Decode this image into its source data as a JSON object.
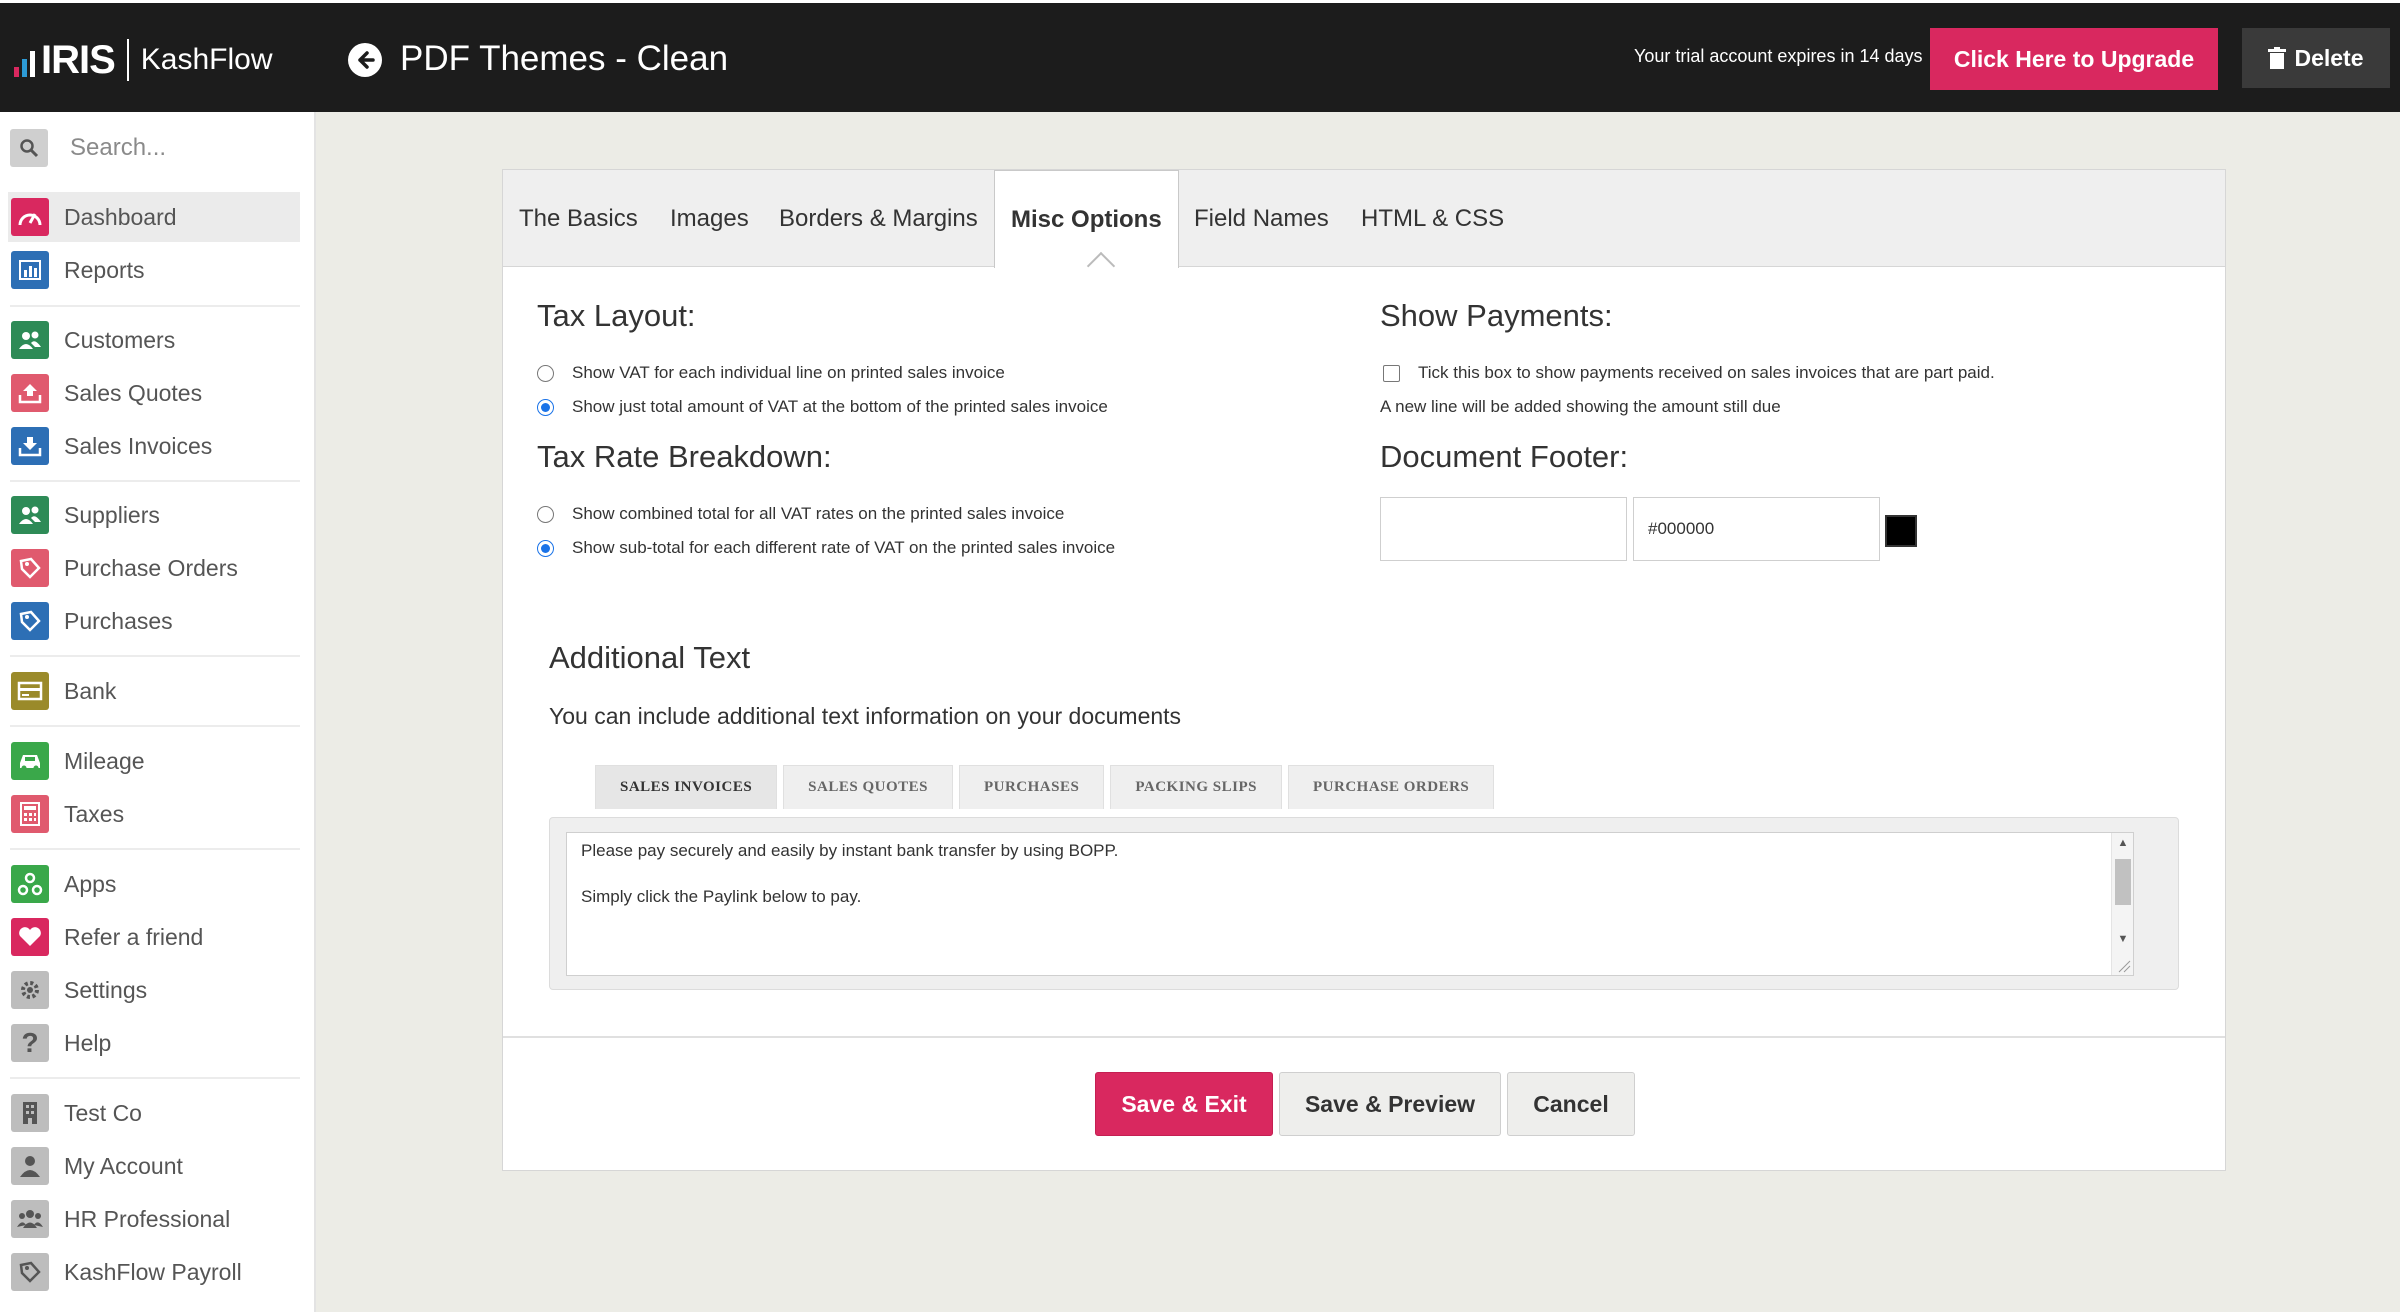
{
  "header": {
    "logo_iris": "IRIS",
    "logo_kashflow": "KashFlow",
    "title": "PDF Themes - Clean",
    "trial_text": "Your trial account expires in 14 days",
    "upgrade_label": "Click Here to Upgrade",
    "delete_label": "Delete"
  },
  "sidebar": {
    "search_placeholder": "Search...",
    "items": [
      {
        "label": "Dashboard",
        "icon": "dashboard-icon",
        "color": "#d9285f"
      },
      {
        "label": "Reports",
        "icon": "bar-chart-icon",
        "color": "#2d6fb5"
      },
      {
        "label": "Customers",
        "icon": "users-icon",
        "color": "#2e8b57"
      },
      {
        "label": "Sales Quotes",
        "icon": "upload-icon",
        "color": "#e05a6e"
      },
      {
        "label": "Sales Invoices",
        "icon": "download-icon",
        "color": "#2d6fb5"
      },
      {
        "label": "Suppliers",
        "icon": "users-icon",
        "color": "#2e8b57"
      },
      {
        "label": "Purchase Orders",
        "icon": "tag-icon",
        "color": "#e05a6e"
      },
      {
        "label": "Purchases",
        "icon": "tag-icon",
        "color": "#2d6fb5"
      },
      {
        "label": "Bank",
        "icon": "card-icon",
        "color": "#9a8a2a"
      },
      {
        "label": "Mileage",
        "icon": "car-icon",
        "color": "#3aa84a"
      },
      {
        "label": "Taxes",
        "icon": "calculator-icon",
        "color": "#e05a6e"
      },
      {
        "label": "Apps",
        "icon": "apps-icon",
        "color": "#3aa84a"
      },
      {
        "label": "Refer a friend",
        "icon": "heart-icon",
        "color": "#d9285f"
      },
      {
        "label": "Settings",
        "icon": "gear-icon",
        "color": "#bdbdbd"
      },
      {
        "label": "Help",
        "icon": "help-icon",
        "color": "#bdbdbd"
      },
      {
        "label": "Test Co",
        "icon": "building-icon",
        "color": "#bdbdbd"
      },
      {
        "label": "My Account",
        "icon": "user-icon",
        "color": "#bdbdbd"
      },
      {
        "label": "HR Professional",
        "icon": "group-icon",
        "color": "#bdbdbd"
      },
      {
        "label": "KashFlow Payroll",
        "icon": "tag-icon",
        "color": "#bdbdbd"
      }
    ]
  },
  "tabs": [
    {
      "label": "The Basics"
    },
    {
      "label": "Images"
    },
    {
      "label": "Borders & Margins"
    },
    {
      "label": "Misc Options"
    },
    {
      "label": "Field Names"
    },
    {
      "label": "HTML & CSS"
    }
  ],
  "tax_layout": {
    "title": "Tax Layout:",
    "options": [
      {
        "label": "Show VAT for each individual line on printed sales invoice",
        "checked": false
      },
      {
        "label": "Show just total amount of VAT at the bottom of the printed sales invoice",
        "checked": true
      }
    ]
  },
  "tax_rate": {
    "title": "Tax Rate Breakdown:",
    "options": [
      {
        "label": "Show combined total for all VAT rates on the printed sales invoice",
        "checked": false
      },
      {
        "label": "Show sub-total for each different rate of VAT on the printed sales invoice",
        "checked": true
      }
    ]
  },
  "show_payments": {
    "title": "Show Payments:",
    "checkbox_label": "Tick this box to show payments received on sales invoices that are part paid.",
    "note": "A new line will be added showing the amount still due"
  },
  "document_footer": {
    "title": "Document Footer:",
    "text_value": "",
    "color_value": "#000000"
  },
  "additional_text": {
    "title": "Additional Text",
    "description": "You can include additional text information on your documents",
    "subtabs": [
      "SALES INVOICES",
      "SALES QUOTES",
      "PURCHASES",
      "PACKING SLIPS",
      "PURCHASE ORDERS"
    ],
    "line1": "Please pay securely and easily by instant bank transfer by using BOPP.",
    "line2": "Simply click the Paylink below to pay."
  },
  "actions": {
    "save_exit": "Save & Exit",
    "save_preview": "Save & Preview",
    "cancel": "Cancel"
  },
  "colors": {
    "accent": "#d9285f",
    "header_bg": "#1c1c1c",
    "radio_checked": "#1a73e8"
  }
}
